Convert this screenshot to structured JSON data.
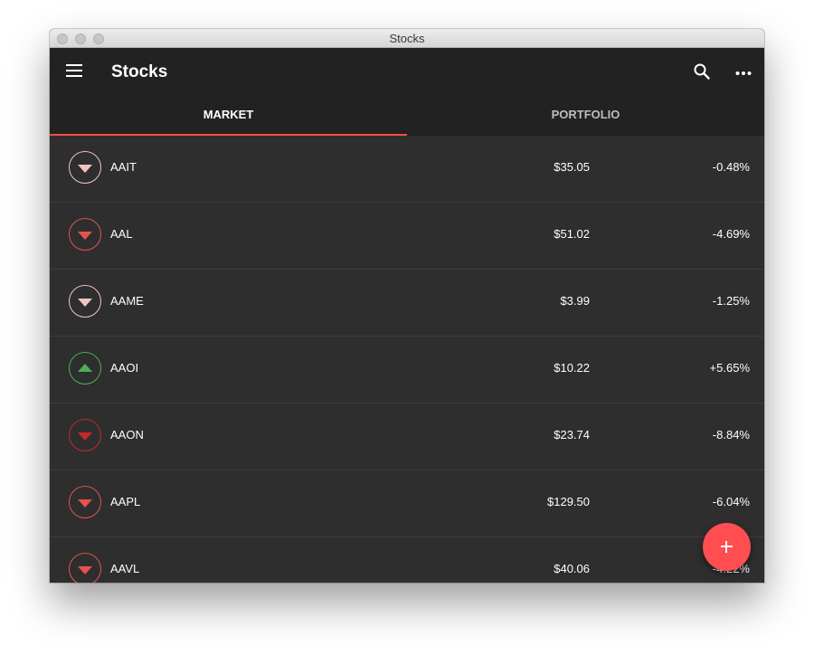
{
  "window": {
    "title": "Stocks"
  },
  "appbar": {
    "title": "Stocks",
    "menu_icon": "menu-icon",
    "search_icon": "search-icon",
    "more_icon": "more-icon"
  },
  "tabs": [
    {
      "label": "MARKET",
      "active": true
    },
    {
      "label": "PORTFOLIO",
      "active": false
    }
  ],
  "colors": {
    "accent": "#ff4c4c",
    "down_light": "#f2c3c3",
    "down": "#e5534b",
    "down_dark": "#c62828",
    "up": "#4caf50"
  },
  "stocks": [
    {
      "symbol": "AAIT",
      "price": "$35.05",
      "change": "-0.48%",
      "trend": "down",
      "color": "#f2c3c3"
    },
    {
      "symbol": "AAL",
      "price": "$51.02",
      "change": "-4.69%",
      "trend": "down",
      "color": "#e5534b"
    },
    {
      "symbol": "AAME",
      "price": "$3.99",
      "change": "-1.25%",
      "trend": "down",
      "color": "#f2c3c3"
    },
    {
      "symbol": "AAOI",
      "price": "$10.22",
      "change": "+5.65%",
      "trend": "up",
      "color": "#4caf50"
    },
    {
      "symbol": "AAON",
      "price": "$23.74",
      "change": "-8.84%",
      "trend": "down",
      "color": "#c62828"
    },
    {
      "symbol": "AAPL",
      "price": "$129.50",
      "change": "-6.04%",
      "trend": "down",
      "color": "#e5534b"
    },
    {
      "symbol": "AAVL",
      "price": "$40.06",
      "change": "-4.22%",
      "trend": "down",
      "color": "#e5534b"
    }
  ],
  "fab": {
    "icon": "plus-icon"
  }
}
